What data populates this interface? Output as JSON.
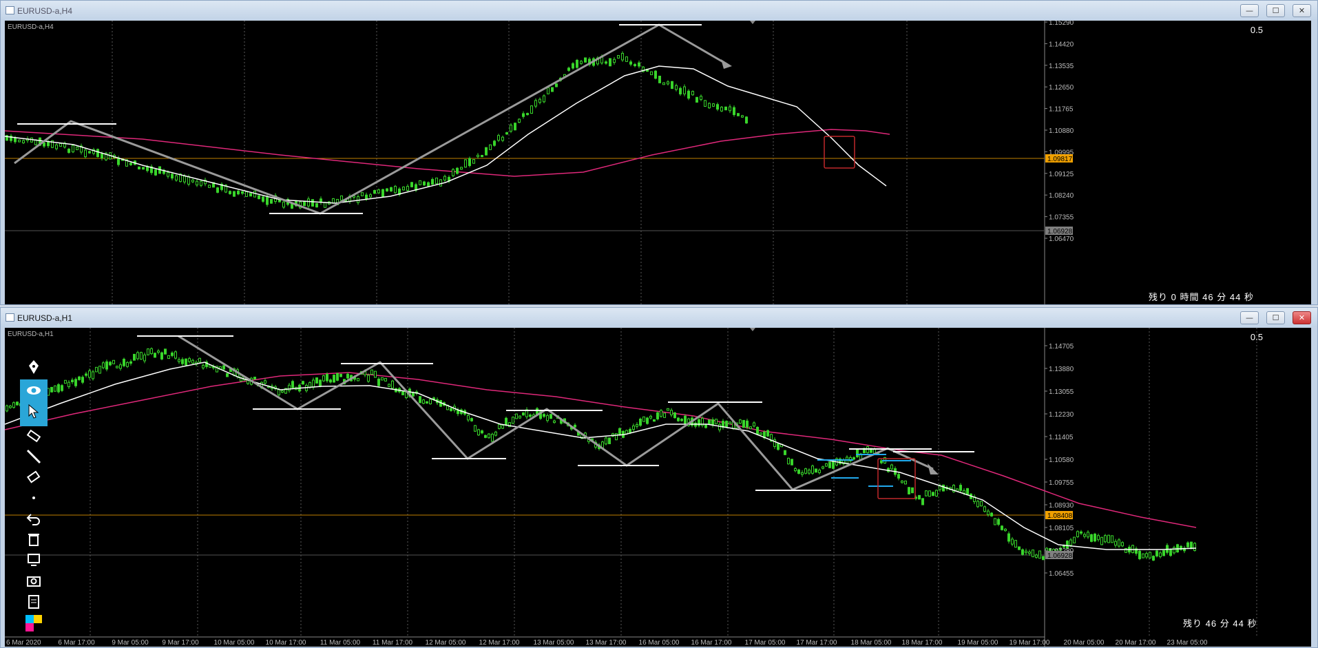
{
  "windows": [
    {
      "id": "top",
      "title": "EURUSD-a,H4",
      "symbol_label": "EURUSD-a,H4",
      "scale": "0.5",
      "countdown": {
        "prefix": "残り",
        "hours": "0",
        "hours_unit": "時間",
        "minutes": "46",
        "minutes_unit": "分",
        "seconds": "44",
        "seconds_unit": "秒"
      },
      "price_axis": [
        "1.15290",
        "1.14420",
        "1.13535",
        "1.12650",
        "1.11765",
        "1.10880",
        "1.09995",
        "1.09125",
        "1.08240",
        "1.07355",
        "1.06470"
      ],
      "price_tags": [
        {
          "value": "1.09817",
          "color": "#f0a000"
        },
        {
          "value": "1.06928",
          "color": "#808080"
        }
      ],
      "buttons": {
        "minimize": "—",
        "maximize": "☐",
        "close": "✕"
      }
    },
    {
      "id": "bottom",
      "title": "EURUSD-a,H1",
      "symbol_label": "EURUSD-a,H1",
      "scale": "0.5",
      "countdown": {
        "prefix": "残り",
        "minutes": "46",
        "minutes_unit": "分",
        "seconds": "44",
        "seconds_unit": "秒"
      },
      "price_axis": [
        "1.14705",
        "1.13880",
        "1.13055",
        "1.12230",
        "1.11405",
        "1.10580",
        "1.09755",
        "1.08930",
        "1.08105",
        "1.07280",
        "1.06455"
      ],
      "price_tags": [
        {
          "value": "1.08408",
          "color": "#f0a000"
        },
        {
          "value": "1.06928",
          "color": "#808080"
        }
      ],
      "time_axis": [
        "6 Mar 2020",
        "6 Mar 17:00",
        "9 Mar 05:00",
        "9 Mar 17:00",
        "10 Mar 05:00",
        "10 Mar 17:00",
        "11 Mar 05:00",
        "11 Mar 17:00",
        "12 Mar 05:00",
        "12 Mar 17:00",
        "13 Mar 05:00",
        "13 Mar 17:00",
        "16 Mar 05:00",
        "16 Mar 17:00",
        "17 Mar 05:00",
        "17 Mar 17:00",
        "18 Mar 05:00",
        "18 Mar 17:00",
        "19 Mar 05:00",
        "19 Mar 17:00",
        "20 Mar 05:00",
        "20 Mar 17:00",
        "23 Mar 05:00"
      ],
      "buttons": {
        "minimize": "—",
        "maximize": "☐",
        "close": "✕"
      }
    }
  ],
  "drawing_toolbar": {
    "tools": [
      "pen-icon",
      "eye-icon",
      "cursor-icon",
      "highlighter-icon",
      "line-icon",
      "eraser-icon",
      "dot-icon",
      "undo-icon",
      "trash-icon",
      "monitor-icon",
      "camera-icon",
      "clipboard-icon",
      "color-palette"
    ],
    "palette_colors": [
      "#00bfff",
      "#ffd400",
      "#ff1493",
      "#000000"
    ]
  },
  "colors": {
    "candle": "#39d52b",
    "ma_fast": "#ffffff",
    "ma_slow": "#e0287a",
    "zigzag": "#9a9a9a",
    "grid": "#5a5a5a",
    "box": "#c0282a",
    "level_blue": "#22aaee"
  }
}
